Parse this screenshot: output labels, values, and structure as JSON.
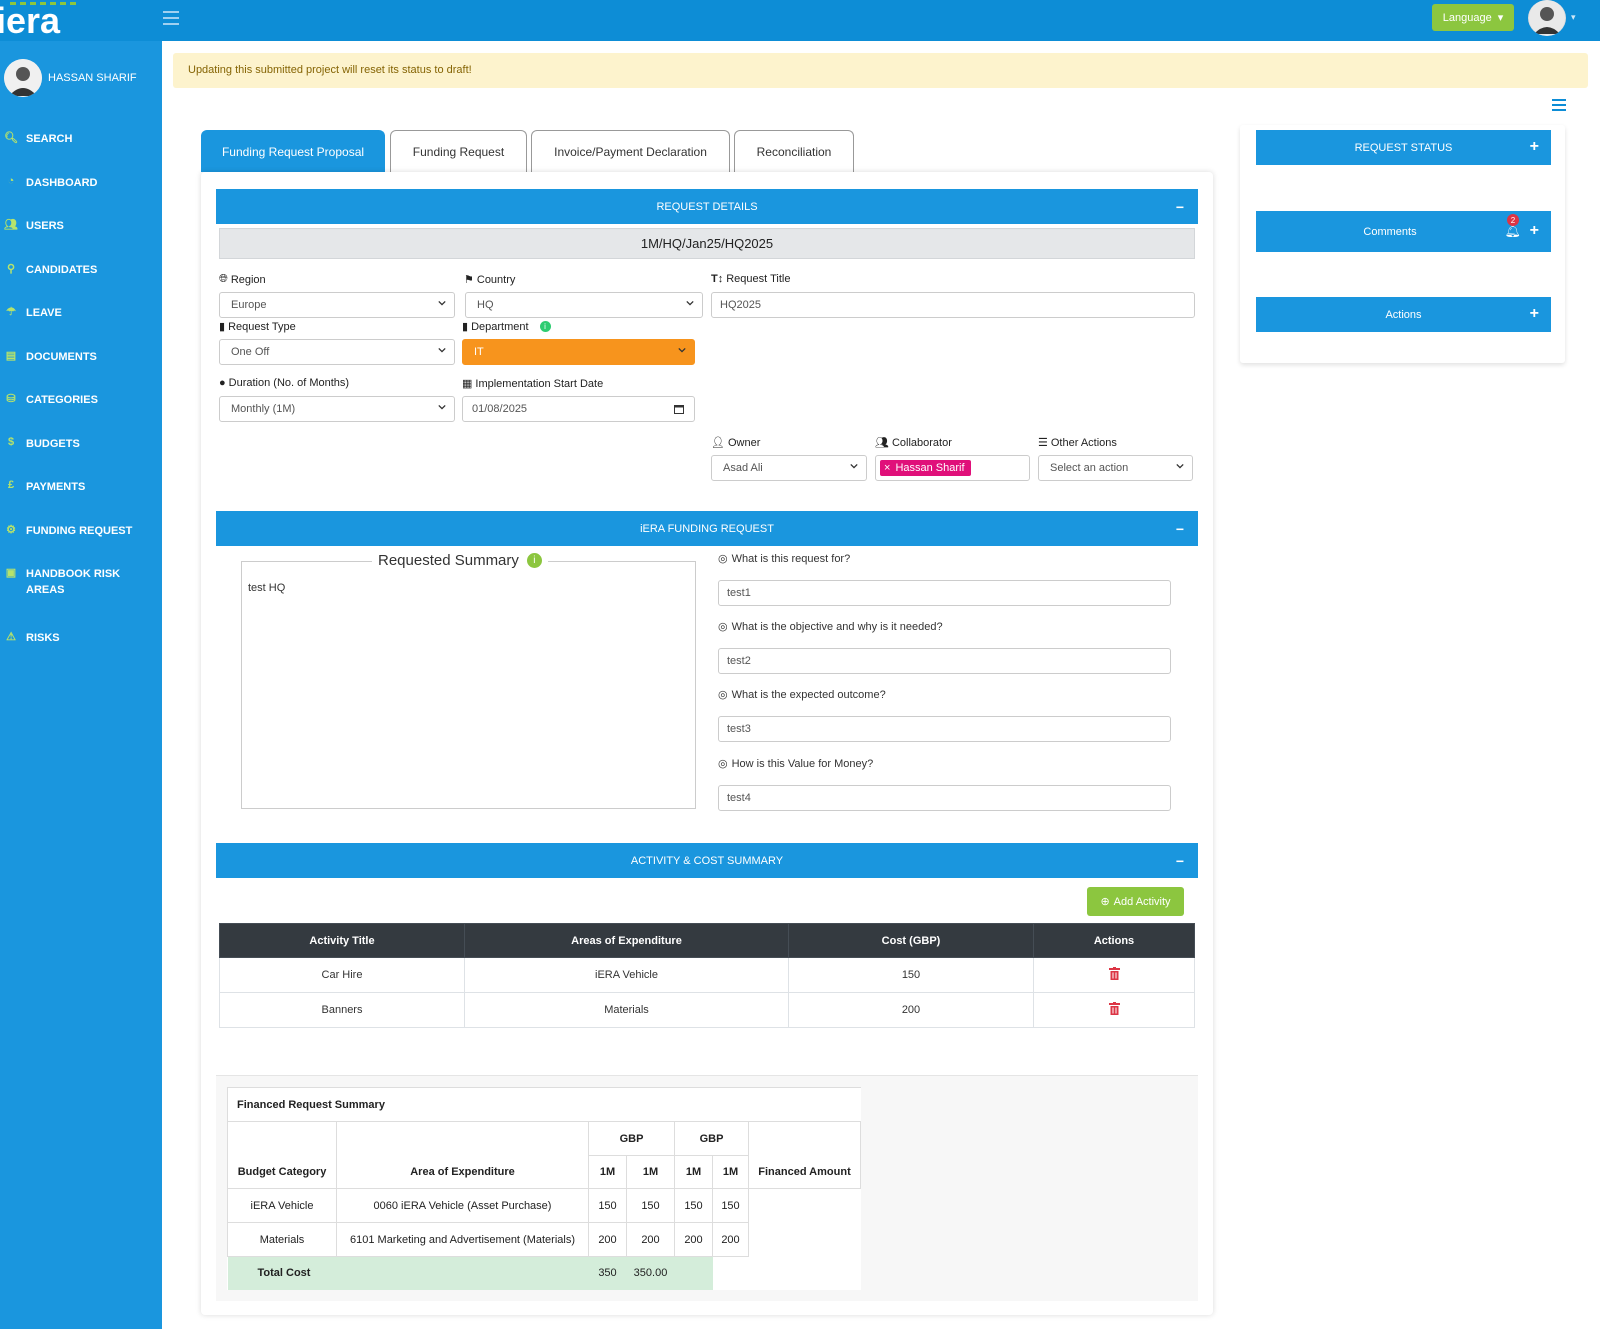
{
  "topbar": {
    "logo_text": "iera",
    "language_label": "Language"
  },
  "user": {
    "name": "HASSAN SHARIF"
  },
  "nav": [
    {
      "label": "SEARCH",
      "icon": "search-icon"
    },
    {
      "label": "DASHBOARD",
      "icon": "dashboard-icon"
    },
    {
      "label": "USERS",
      "icon": "users-icon"
    },
    {
      "label": "CANDIDATES",
      "icon": "candidates-icon"
    },
    {
      "label": "LEAVE",
      "icon": "leave-icon"
    },
    {
      "label": "DOCUMENTS",
      "icon": "documents-icon"
    },
    {
      "label": "CATEGORIES",
      "icon": "categories-icon"
    },
    {
      "label": "BUDGETS",
      "icon": "budgets-icon"
    },
    {
      "label": "PAYMENTS",
      "icon": "pound-icon"
    },
    {
      "label": "FUNDING REQUEST",
      "icon": "funding-icon"
    },
    {
      "label": "HANDBOOK RISK AREAS",
      "icon": "handbook-icon"
    },
    {
      "label": "RISKS",
      "icon": "warning-icon"
    }
  ],
  "alert": "Updating this submitted project will reset its status to draft!",
  "tabs": [
    "Funding Request Proposal",
    "Funding Request",
    "Invoice/Payment Declaration",
    "Reconciliation"
  ],
  "request_details": {
    "header": "REQUEST DETAILS",
    "reference": "1M/HQ/Jan25/HQ2025",
    "region_label": "Region",
    "region_value": "Europe",
    "country_label": "Country",
    "country_value": "HQ",
    "title_label": "Request Title",
    "title_value": "HQ2025",
    "type_label": "Request Type",
    "type_value": "One Off",
    "department_label": "Department",
    "department_value": "IT",
    "duration_label": "Duration (No. of Months)",
    "duration_value": "Monthly (1M)",
    "start_label": "Implementation Start Date",
    "start_value": "01/08/2025",
    "owner_label": "Owner",
    "owner_value": "Asad Ali",
    "collab_label": "Collaborator",
    "collab_value": "Hassan Sharif",
    "other_label": "Other Actions",
    "other_value": "Select an action"
  },
  "funding_request": {
    "header": "iERA FUNDING REQUEST",
    "summary_title": "Requested Summary",
    "summary_text": "test HQ",
    "questions": [
      {
        "q": "What is this request for?",
        "a": "test1"
      },
      {
        "q": "What is the objective and why is it needed?",
        "a": "test2"
      },
      {
        "q": "What is the expected outcome?",
        "a": "test3"
      },
      {
        "q": "How is this Value for Money?",
        "a": "test4"
      }
    ]
  },
  "activity": {
    "header": "ACTIVITY & COST SUMMARY",
    "add_label": "Add Activity",
    "columns": [
      "Activity Title",
      "Areas of Expenditure",
      "Cost (GBP)",
      "Actions"
    ],
    "rows": [
      {
        "title": "Car Hire",
        "area": "iERA Vehicle",
        "cost": "150"
      },
      {
        "title": "Banners",
        "area": "Materials",
        "cost": "200"
      }
    ]
  },
  "financed": {
    "title": "Financed Request Summary",
    "currency": "GBP",
    "col_budget": "Budget Category",
    "col_area": "Area of Expenditure",
    "col_period": "1M",
    "col_financed": "Financed Amount",
    "rows": [
      {
        "cat": "iERA Vehicle",
        "area": "0060 iERA Vehicle (Asset Purchase)",
        "v": [
          "150",
          "150",
          "150",
          "150"
        ]
      },
      {
        "cat": "Materials",
        "area": "6101 Marketing and Advertisement (Materials)",
        "v": [
          "200",
          "200",
          "200",
          "200"
        ]
      }
    ],
    "total_label": "Total Cost",
    "total_values": [
      "350",
      "350.00"
    ]
  },
  "right_panel": {
    "status": "REQUEST STATUS",
    "comments": "Comments",
    "comments_badge": "2",
    "actions": "Actions"
  },
  "colors": {
    "primary": "#1a96de",
    "green": "#8cc63f",
    "orange": "#f7941d",
    "pink": "#e0107a",
    "danger": "#dc3545"
  }
}
